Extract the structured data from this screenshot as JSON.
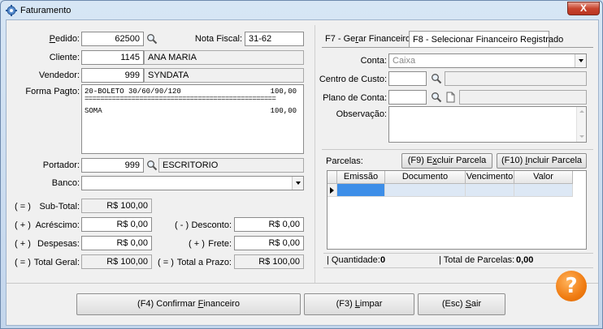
{
  "window": {
    "title": "Faturamento",
    "close_glyph": "X"
  },
  "pedido": {
    "label_u": "P",
    "label_rest": "edido:",
    "value": "62500"
  },
  "nota_fiscal": {
    "label": "Nota Fiscal:",
    "value": "31-62"
  },
  "cliente": {
    "label": "Cliente:",
    "code": "1145",
    "name": "ANA MARIA"
  },
  "vendedor": {
    "label": "Vendedor:",
    "code": "999",
    "name": "SYNDATA"
  },
  "forma_pagto": {
    "label": "Forma Pagto:",
    "line1_left": "20-BOLETO 30/60/90/120",
    "line1_right": "100,00",
    "separator": "=================================================",
    "line2_left": "SOMA",
    "line2_right": "100,00"
  },
  "portador": {
    "label": "Portador:",
    "code": "999",
    "name": "ESCRITORIO"
  },
  "banco": {
    "label": "Banco:",
    "value": ""
  },
  "totals": {
    "subtotal": {
      "sign": "( = )",
      "label": "Sub-Total:",
      "value": "R$ 100,00"
    },
    "acrescimo": {
      "sign": "( + )",
      "label": "Acréscimo:",
      "value": "R$ 0,00"
    },
    "desconto": {
      "sign": "( - )",
      "label": "Desconto:",
      "value": "R$ 0,00"
    },
    "despesas": {
      "sign": "( + )",
      "label": "Despesas:",
      "value": "R$ 0,00"
    },
    "frete": {
      "sign": "( + )",
      "label": "Frete:",
      "value": "R$ 0,00"
    },
    "total_geral": {
      "sign": "( = )",
      "label": "Total Geral:",
      "value": "R$ 100,00"
    },
    "total_prazo": {
      "sign": "( = )",
      "label": "Total a Prazo:",
      "value": "R$ 100,00"
    }
  },
  "tabs": {
    "gerar_a": "F7 - Ge",
    "gerar_u": "r",
    "gerar_b": "ar Financeiro",
    "selecionar": "F8 - Selecionar Financeiro Registrado"
  },
  "conta": {
    "label": "Conta:",
    "value": "Caixa"
  },
  "centro_custo": {
    "label": "Centro de Custo:"
  },
  "plano_conta": {
    "label": "Plano de Conta:"
  },
  "observacao": {
    "label": "Observação:"
  },
  "parcelas": {
    "label": "Parcelas:",
    "excluir_a": "(F9) E",
    "excluir_u": "x",
    "excluir_b": "cluir Parcela",
    "incluir_a": "(F10) ",
    "incluir_u": "I",
    "incluir_b": "ncluir Parcela",
    "columns": [
      "Emissão",
      "Documento",
      "Vencimento",
      "Valor"
    ]
  },
  "footer_stats": {
    "quantidade_label": "| Quantidade:",
    "quantidade_value": "0",
    "total_label": "| Total de Parcelas:",
    "total_value": "0,00"
  },
  "buttons": {
    "confirmar_a": "(F4) Confirmar ",
    "confirmar_u": "F",
    "confirmar_b": "inanceiro",
    "limpar_a": "(F3) ",
    "limpar_u": "L",
    "limpar_b": "impar",
    "sair_a": "(Esc) ",
    "sair_u": "S",
    "sair_b": "air"
  },
  "help": {
    "glyph": "?"
  },
  "colors": {
    "help": "#f07c12",
    "close": "#c8452f",
    "grid_selected": "#3d8ee8"
  }
}
